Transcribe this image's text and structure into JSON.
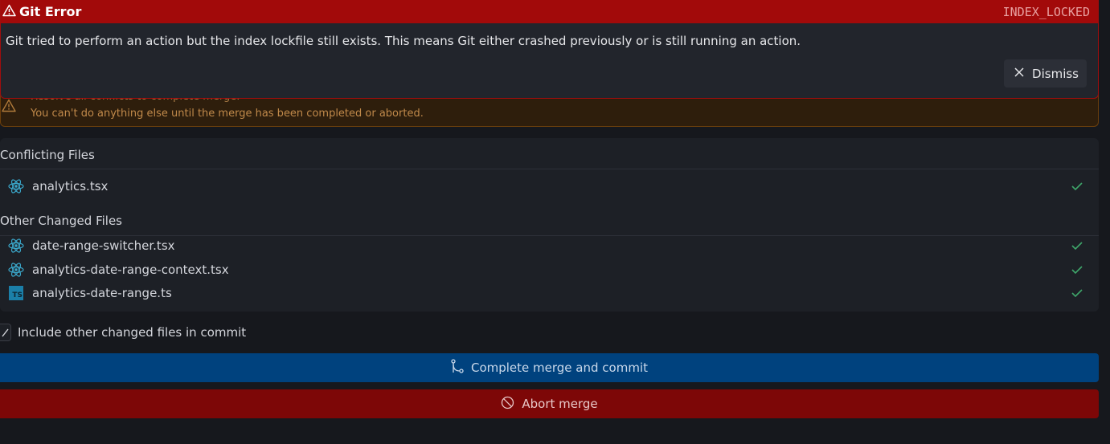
{
  "error": {
    "title": "Git Error",
    "code": "INDEX_LOCKED",
    "message": "Git tried to perform an action but the index lockfile still exists. This means Git either crashed previously or is still running an action.",
    "dismiss_label": "Dismiss",
    "icon": "warning-triangle-icon"
  },
  "merge_warning": {
    "line1": "Resolve all conflicts to complete merge.",
    "line2": "You can't do anything else until the merge has been completed or aborted.",
    "icon": "warning-triangle-icon"
  },
  "conflicting": {
    "title": "Conflicting Files",
    "files": [
      {
        "name": "analytics.tsx",
        "icon": "react-icon",
        "resolved": true
      }
    ]
  },
  "other_changed": {
    "title": "Other Changed Files",
    "files": [
      {
        "name": "date-range-switcher.tsx",
        "icon": "react-icon",
        "resolved": true
      },
      {
        "name": "analytics-date-range-context.tsx",
        "icon": "react-icon",
        "resolved": true
      },
      {
        "name": "analytics-date-range.ts",
        "icon": "typescript-icon",
        "resolved": true
      }
    ]
  },
  "include_checkbox": {
    "label": "Include other changed files in commit",
    "checked": true
  },
  "actions": {
    "commit_label": "Complete merge and commit",
    "abort_label": "Abort merge"
  },
  "colors": {
    "error_red": "#a20a0a",
    "warning_brown": "#2e1e0c",
    "commit_blue": "#00427e",
    "abort_red": "#7d0707",
    "check_green": "#3fa66a",
    "react_blue": "#3aa6c9"
  }
}
